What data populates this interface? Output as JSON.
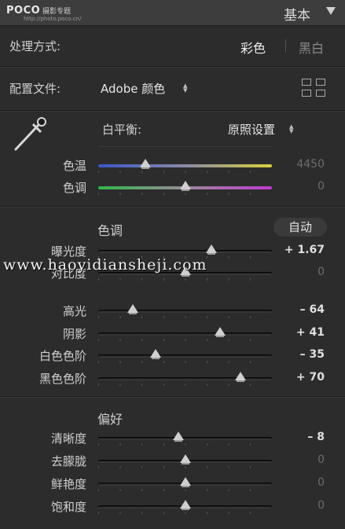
{
  "header": {
    "logo": "POCO",
    "logo_subtitle": "摄影专题",
    "logo_url": "http://photo.poco.cn/",
    "panel_title": "基本"
  },
  "treatment": {
    "label": "处理方式:",
    "color": "彩色",
    "bw": "黑白"
  },
  "profile": {
    "label": "配置文件:",
    "value": "Adobe 颜色"
  },
  "white_balance": {
    "label": "白平衡:",
    "value": "原照设置"
  },
  "wb_sliders": [
    {
      "label": "色温",
      "value": "4450",
      "level": 0.27,
      "track": "temp",
      "dim": true
    },
    {
      "label": "色调",
      "value": "0",
      "level": 0.5,
      "track": "tint",
      "dim": true
    }
  ],
  "tone": {
    "title": "色调",
    "auto_label": "自动",
    "sliders": [
      {
        "label": "曝光度",
        "value": "+ 1.67",
        "level": 0.65,
        "dim": false
      },
      {
        "label": "对比度",
        "value": "0",
        "level": 0.5,
        "dim": true
      },
      {
        "label": "高光",
        "value": "– 64",
        "level": 0.2,
        "dim": false
      },
      {
        "label": "阴影",
        "value": "+ 41",
        "level": 0.7,
        "dim": false
      },
      {
        "label": "白色色阶",
        "value": "– 35",
        "level": 0.33,
        "dim": false
      },
      {
        "label": "黑色色阶",
        "value": "+ 70",
        "level": 0.82,
        "dim": false
      }
    ]
  },
  "presence": {
    "title": "偏好",
    "sliders": [
      {
        "label": "清晰度",
        "value": "– 8",
        "level": 0.46,
        "dim": false
      },
      {
        "label": "去朦胧",
        "value": "0",
        "level": 0.5,
        "dim": true
      },
      {
        "label": "鲜艳度",
        "value": "0",
        "level": 0.5,
        "dim": true
      },
      {
        "label": "饱和度",
        "value": "0",
        "level": 0.5,
        "dim": true
      }
    ]
  },
  "watermark": "www.haoyidiansheji.com",
  "icons": {
    "eyedropper": "eyedropper-icon",
    "grid": "grid-icon",
    "collapse": "triangle-down-icon",
    "updown": "updown-arrows-icon"
  }
}
